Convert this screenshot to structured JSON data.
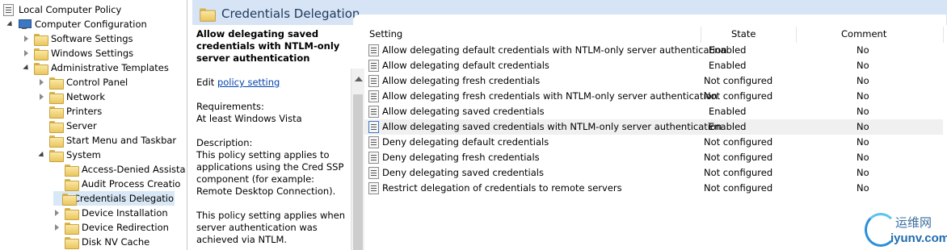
{
  "tree": {
    "root_label": "Local Computer Policy",
    "computer_config": "Computer Configuration",
    "software_settings": "Software Settings",
    "windows_settings": "Windows Settings",
    "admin_templates": "Administrative Templates",
    "control_panel": "Control Panel",
    "network": "Network",
    "printers": "Printers",
    "server": "Server",
    "start_menu": "Start Menu and Taskbar",
    "system": "System",
    "access_denied": "Access-Denied Assista",
    "audit_process": "Audit Process Creatio",
    "credentials_delegation": "Credentials Delegatio",
    "device_installation": "Device Installation",
    "device_redirection": "Device Redirection",
    "disk_nv_cache": "Disk NV Cache"
  },
  "header": {
    "title": "Credentials Delegation"
  },
  "description": {
    "title": "Allow delegating saved credentials with NTLM-only server authentication",
    "edit_prefix": "Edit",
    "edit_link": "policy setting",
    "req_label": "Requirements:",
    "req_value": "At least Windows Vista",
    "desc_label": "Description:",
    "desc_p1": "This policy setting applies to applications using the Cred SSP component (for example: Remote Desktop Connection).",
    "desc_p2": "This policy setting applies when server authentication was achieved via NTLM."
  },
  "list": {
    "columns": {
      "setting": "Setting",
      "state": "State",
      "comment": "Comment"
    },
    "rows": [
      {
        "setting": "Allow delegating default credentials with NTLM-only server authentication",
        "state": "Enabled",
        "comment": "No"
      },
      {
        "setting": "Allow delegating default credentials",
        "state": "Enabled",
        "comment": "No"
      },
      {
        "setting": "Allow delegating fresh credentials",
        "state": "Not configured",
        "comment": "No"
      },
      {
        "setting": "Allow delegating fresh credentials with NTLM-only server authentication",
        "state": "Not configured",
        "comment": "No"
      },
      {
        "setting": "Allow delegating saved credentials",
        "state": "Enabled",
        "comment": "No"
      },
      {
        "setting": "Allow delegating saved credentials with NTLM-only server authentication",
        "state": "Enabled",
        "comment": "No"
      },
      {
        "setting": "Deny delegating default credentials",
        "state": "Not configured",
        "comment": "No"
      },
      {
        "setting": "Deny delegating fresh credentials",
        "state": "Not configured",
        "comment": "No"
      },
      {
        "setting": "Deny delegating saved credentials",
        "state": "Not configured",
        "comment": "No"
      },
      {
        "setting": "Restrict delegation of credentials to remote servers",
        "state": "Not configured",
        "comment": "No"
      }
    ]
  },
  "watermark": {
    "cn": "运维网",
    "en": "iyunv.com"
  }
}
